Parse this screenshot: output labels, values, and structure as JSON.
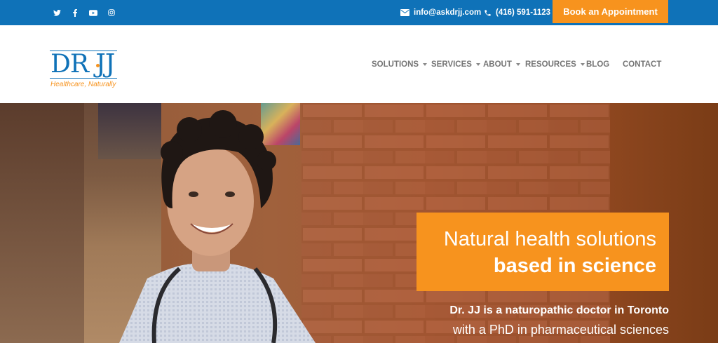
{
  "topbar": {
    "social": [
      {
        "icon": "twitter-icon"
      },
      {
        "icon": "facebook-icon"
      },
      {
        "icon": "youtube-icon"
      },
      {
        "icon": "instagram-icon"
      }
    ],
    "email": "info@askdrjj.com",
    "phone": "(416) 591-1123",
    "cta": "Book an Appointment"
  },
  "logo": {
    "mark": "DR JJ",
    "tagline": "Healthcare, Naturally"
  },
  "nav": {
    "items": [
      {
        "label": "SOLUTIONS",
        "has_dropdown": true
      },
      {
        "label": "SERVICES",
        "has_dropdown": true
      },
      {
        "label": "ABOUT",
        "has_dropdown": true
      },
      {
        "label": "RESOURCES",
        "has_dropdown": true
      },
      {
        "label": "BLOG",
        "has_dropdown": false
      },
      {
        "label": "CONTACT",
        "has_dropdown": false
      }
    ]
  },
  "hero": {
    "headline_line1": "Natural health solutions",
    "headline_line2": "based in science",
    "intro_line1": "Dr. JJ is a naturopathic doctor in Toronto",
    "intro_line2": "with a PhD in pharmaceutical sciences"
  },
  "colors": {
    "brand_blue": "#0f72b8",
    "accent_orange": "#f7931e",
    "nav_text": "#757575"
  }
}
